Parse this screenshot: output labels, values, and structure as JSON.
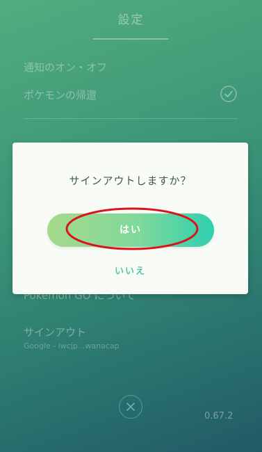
{
  "settings": {
    "title": "設定",
    "notifications_label": "通知のオン・オフ",
    "pokemon_return_label": "ポケモンの帰還",
    "about_label": "Pokémon GO について",
    "signout_label": "サインアウト",
    "signout_account": "Google - iwcjp...wanacap",
    "version": "0.67.2"
  },
  "dialog": {
    "message": "サインアウトしますか？",
    "yes_label": "はい",
    "no_label": "いいえ"
  },
  "colors": {
    "accent": "#56c3a4",
    "annotation_circle": "#d9141b"
  },
  "icons": {
    "check": "check-icon",
    "close": "close-icon"
  }
}
